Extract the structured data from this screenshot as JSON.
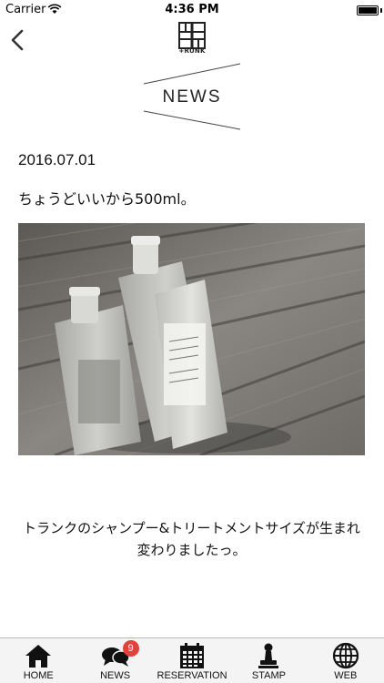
{
  "status_bar": {
    "carrier": "Carrier",
    "time": "4:36 PM"
  },
  "header": {
    "logo_text": "+RUNK",
    "section_title": "NEWS"
  },
  "article": {
    "date": "2016.07.01",
    "title": "ちょうどいいから500ml。",
    "body": "トランクのシャンプー&トリートメントサイズが生まれ変わりましたっ。"
  },
  "tab_bar": {
    "tabs": [
      {
        "label": "HOME",
        "icon": "home-icon"
      },
      {
        "label": "NEWS",
        "icon": "chat-bubbles-icon",
        "badge": "9"
      },
      {
        "label": "RESERVATION",
        "icon": "calendar-icon"
      },
      {
        "label": "STAMP",
        "icon": "stamp-icon"
      },
      {
        "label": "WEB",
        "icon": "globe-icon"
      }
    ]
  }
}
